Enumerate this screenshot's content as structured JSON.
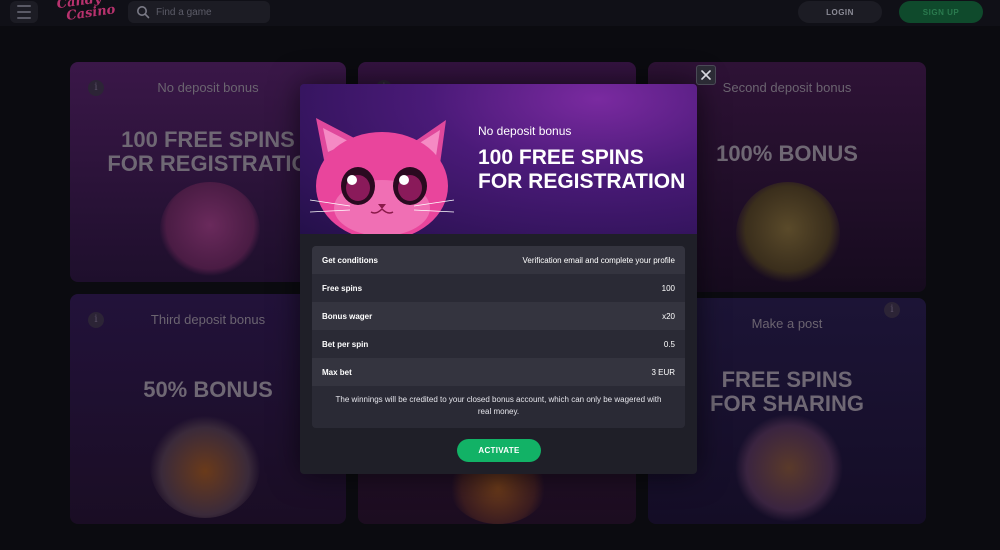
{
  "header": {
    "logo_line1": "Candy",
    "logo_line2": "Casino",
    "search_placeholder": "Find a game",
    "login_label": "LOGIN",
    "signup_label": "SIGN UP"
  },
  "cards": [
    {
      "title": "No deposit bonus",
      "headline_line1": "100 FREE SPINS",
      "headline_line2": "FOR REGISTRATIO"
    },
    {
      "title": "",
      "headline_line1": "",
      "headline_line2": ""
    },
    {
      "title": "Second deposit bonus",
      "headline_line1": "100% BONUS",
      "headline_line2": ""
    },
    {
      "title": "Third deposit bonus",
      "headline_line1": "50% BONUS",
      "headline_line2": ""
    },
    {
      "title": "",
      "headline_line1": "",
      "headline_line2": ""
    },
    {
      "title": "Make a post",
      "headline_line1": "FREE SPINS",
      "headline_line2": "FOR SHARING"
    }
  ],
  "modal": {
    "subtitle": "No deposit bonus",
    "title_line1": "100 FREE SPINS",
    "title_line2": "FOR REGISTRATION",
    "rows": [
      {
        "key": "Get conditions",
        "value": "Verification email and complete your profile"
      },
      {
        "key": "Free spins",
        "value": "100"
      },
      {
        "key": "Bonus wager",
        "value": "x20"
      },
      {
        "key": "Bet per spin",
        "value": "0.5"
      },
      {
        "key": "Max bet",
        "value": "3 EUR"
      }
    ],
    "note_line1": "The winnings will be credited to your closed bonus account, which can only be wagered with",
    "note_line2": "real money.",
    "activate_label": "ACTIVATE"
  },
  "colors": {
    "accent_green": "#12b266",
    "modal_bg": "#1f1f28",
    "banner_purple": "#4a1a78",
    "logo_pink": "#b8326e"
  },
  "icons": {
    "menu": "hamburger-icon",
    "search": "search-icon",
    "close": "close-icon",
    "info": "info-icon"
  }
}
